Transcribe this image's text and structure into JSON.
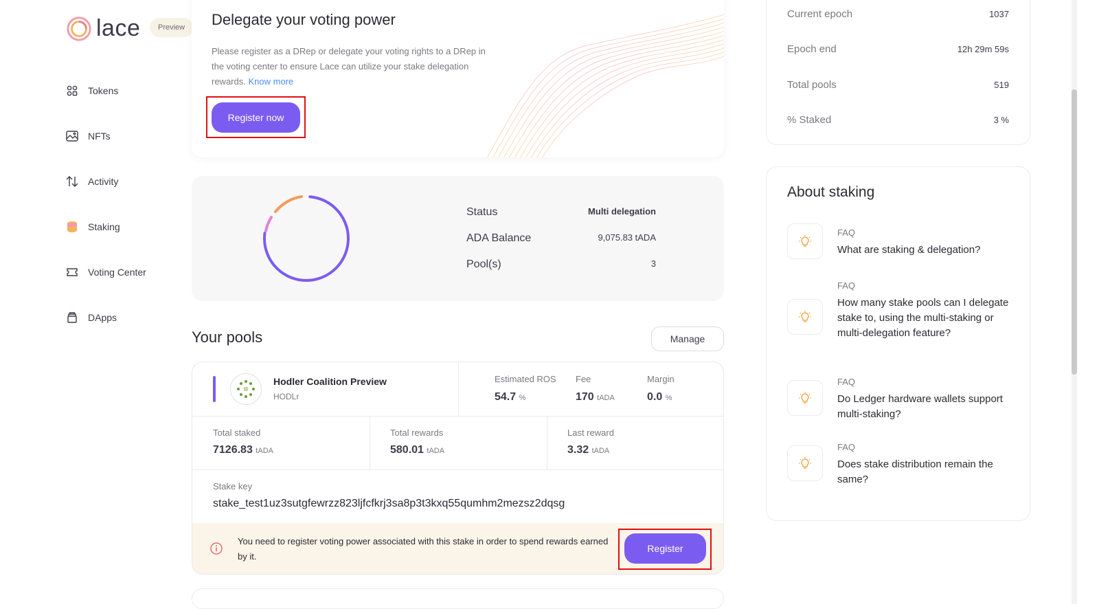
{
  "brand": {
    "name": "lace",
    "badge": "Preview"
  },
  "sidebar": {
    "items": [
      {
        "label": "Tokens",
        "icon": "grid-icon"
      },
      {
        "label": "NFTs",
        "icon": "image-icon"
      },
      {
        "label": "Activity",
        "icon": "arrows-icon"
      },
      {
        "label": "Staking",
        "icon": "coins-icon"
      },
      {
        "label": "Voting Center",
        "icon": "ticket-icon"
      },
      {
        "label": "DApps",
        "icon": "dapps-icon"
      }
    ]
  },
  "delegate_banner": {
    "title": "Delegate your voting power",
    "body": "Please register as a DRep or delegate your voting rights to a DRep in the voting center to ensure Lace can utilize your stake delegation rewards.",
    "link": "Know more",
    "button": "Register now"
  },
  "overview": {
    "status_label": "Status",
    "status_value": "Multi delegation",
    "balance_label": "ADA Balance",
    "balance_value": "9,075.83 tADA",
    "pools_label": "Pool(s)",
    "pools_value": "3"
  },
  "your_pools": {
    "title": "Your pools",
    "manage": "Manage",
    "pool": {
      "name": "Hodler Coalition Preview",
      "ticker": "HODLr",
      "ros_label": "Estimated ROS",
      "ros_value": "54.7",
      "ros_unit": "%",
      "fee_label": "Fee",
      "fee_value": "170",
      "fee_unit": "tADA",
      "margin_label": "Margin",
      "margin_value": "0.0",
      "margin_unit": "%",
      "total_staked_label": "Total staked",
      "total_staked_value": "7126.83",
      "total_staked_unit": "tADA",
      "total_rewards_label": "Total rewards",
      "total_rewards_value": "580.01",
      "total_rewards_unit": "tADA",
      "last_reward_label": "Last reward",
      "last_reward_value": "3.32",
      "last_reward_unit": "tADA",
      "stake_key_label": "Stake key",
      "stake_key_value": "stake_test1uz3sutgfewrzz823ljfcfkrj3sa8p3t3kxq55qumhm2mezsz2dqsg",
      "warning": "You need to register voting power associated with this stake in order to spend rewards earned by it.",
      "register_button": "Register"
    }
  },
  "network": {
    "current_epoch_label": "Current epoch",
    "current_epoch_value": "1037",
    "epoch_end_label": "Epoch end",
    "epoch_end_value": "12h 29m 59s",
    "total_pools_label": "Total pools",
    "total_pools_value": "519",
    "staked_label": "% Staked",
    "staked_value": "3 %"
  },
  "about": {
    "title": "About staking",
    "faqs": [
      {
        "tag": "FAQ",
        "question": "What are staking & delegation?"
      },
      {
        "tag": "FAQ",
        "question": "How many stake pools can I delegate stake to, using the multi-staking or multi-delegation feature?"
      },
      {
        "tag": "FAQ",
        "question": "Do Ledger hardware wallets support multi-staking?"
      },
      {
        "tag": "FAQ",
        "question": "Does stake distribution remain the same?"
      }
    ]
  },
  "colors": {
    "accent": "#7b5cf0",
    "link": "#4a8df8",
    "warning_bg": "#fbf4e8",
    "highlight": "#e01010"
  }
}
